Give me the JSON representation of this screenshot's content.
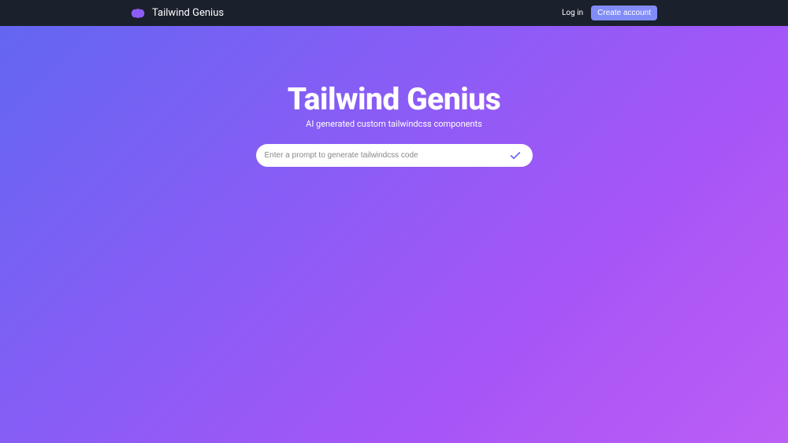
{
  "nav": {
    "brand": "Tailwind Genius",
    "login": "Log in",
    "createAccount": "Create account"
  },
  "hero": {
    "title": "Tailwind Genius",
    "subtitle": "AI generated custom tailwindcss components",
    "promptPlaceholder": "Enter a prompt to generate tailwindcss code"
  }
}
